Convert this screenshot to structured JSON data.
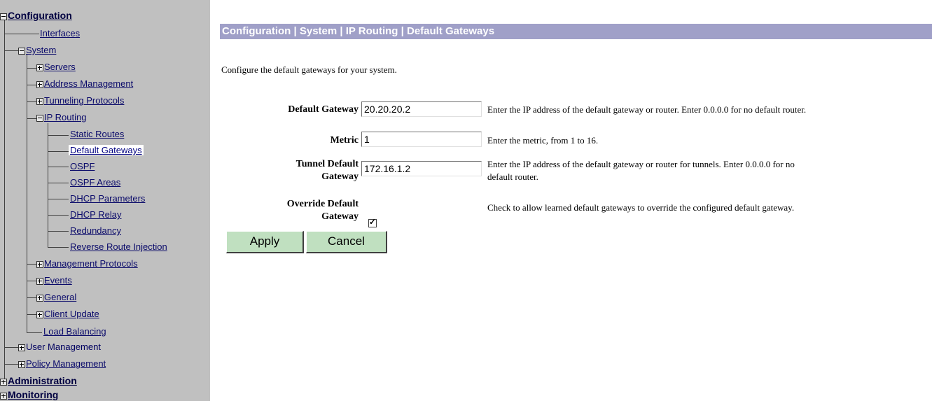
{
  "sidebar": {
    "configuration": "Configuration",
    "interfaces": "Interfaces",
    "system": "System",
    "servers": "Servers",
    "address_management": "Address Management",
    "tunneling_protocols": "Tunneling Protocols",
    "ip_routing": "IP Routing",
    "static_routes": "Static Routes",
    "default_gateways": "Default Gateways",
    "ospf": "OSPF",
    "ospf_areas": "OSPF Areas",
    "dhcp_parameters": "DHCP Parameters",
    "dhcp_relay": "DHCP Relay",
    "redundancy": "Redundancy",
    "reverse_route_injection": "Reverse Route Injection",
    "management_protocols": "Management Protocols",
    "events": "Events",
    "general": "General",
    "client_update": "Client Update",
    "load_balancing": "Load Balancing",
    "user_management": "User Management",
    "policy_management": "Policy Management",
    "administration": "Administration",
    "monitoring": "Monitoring"
  },
  "main": {
    "breadcrumb": "Configuration | System | IP Routing | Default Gateways",
    "intro": "Configure the default gateways for your system.",
    "fields": {
      "default_gateway": {
        "label": "Default Gateway",
        "value": "20.20.20.2",
        "help": "Enter the IP address of the default gateway or router. Enter 0.0.0.0 for no default router."
      },
      "metric": {
        "label": "Metric",
        "value": "1",
        "help": "Enter the metric, from 1 to 16."
      },
      "tunnel_default_gateway": {
        "label_line1": "Tunnel Default",
        "label_line2": "Gateway",
        "value": "172.16.1.2",
        "help_line1": "Enter the IP address of the default gateway or router for tunnels. Enter 0.0.0.0 for no",
        "help_line2": "default router."
      },
      "override_default_gateway": {
        "label_line1": "Override Default",
        "label_line2": "Gateway",
        "checked": true,
        "help": "Check to allow learned default gateways to override the configured default gateway."
      }
    },
    "buttons": {
      "apply": "Apply",
      "cancel": "Cancel"
    }
  },
  "colors": {
    "sidebar_bg": "#c0c0c0",
    "title_bar_bg": "#a0a0c8",
    "button_bg": "#c0e0c0"
  }
}
